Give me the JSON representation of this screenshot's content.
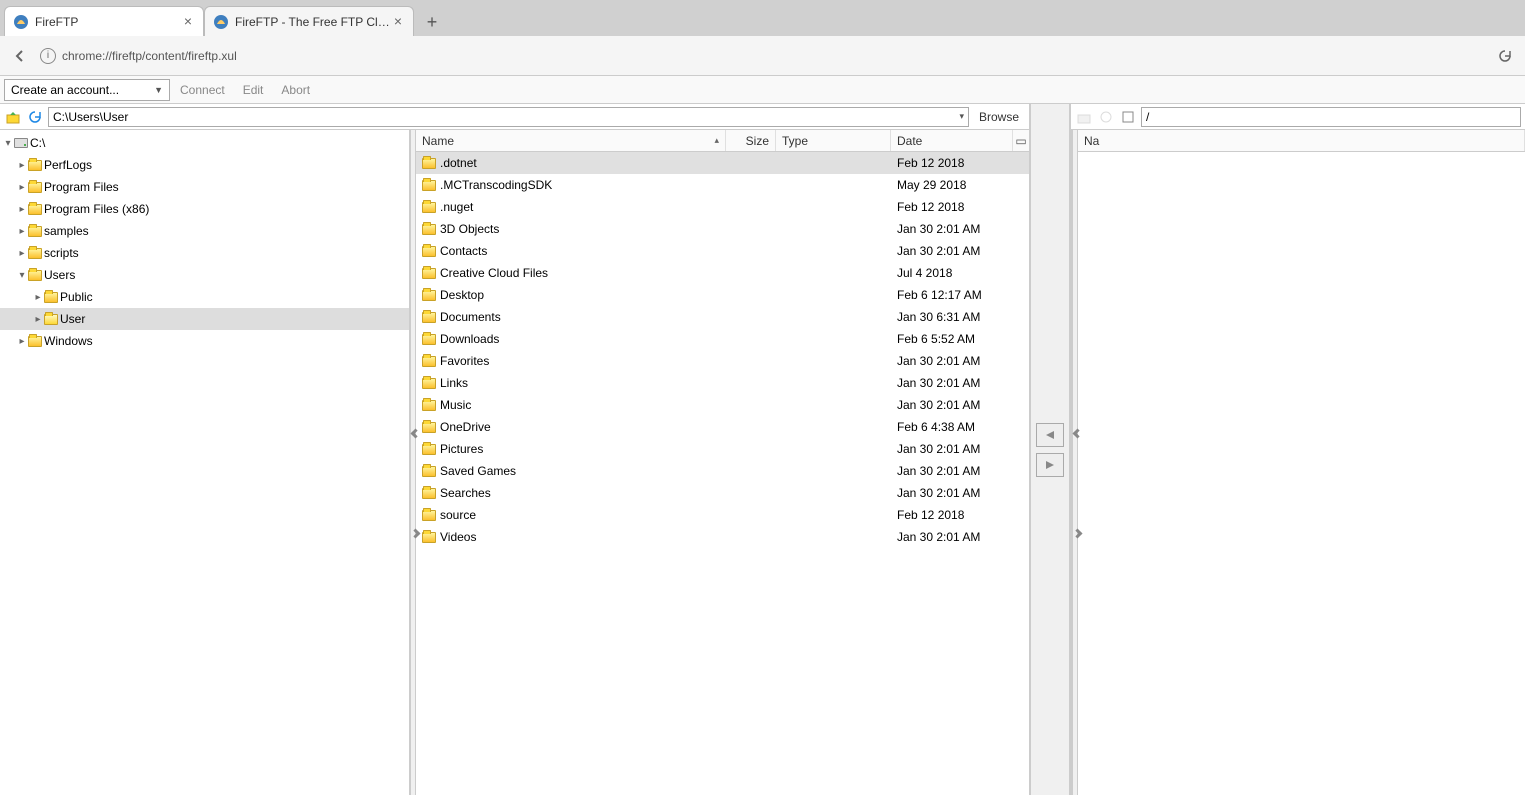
{
  "browser": {
    "tabs": [
      {
        "title": "FireFTP",
        "active": true
      },
      {
        "title": "FireFTP - The Free FTP Clien",
        "active": false
      }
    ],
    "url": "chrome://fireftp/content/fireftp.xul"
  },
  "toolbar": {
    "account_label": "Create an account...",
    "connect": "Connect",
    "edit": "Edit",
    "abort": "Abort"
  },
  "local": {
    "path": "C:\\Users\\User",
    "browse": "Browse",
    "tree": {
      "root": "C:\\",
      "children": [
        {
          "name": "PerfLogs",
          "depth": 1,
          "expandable": true
        },
        {
          "name": "Program Files",
          "depth": 1,
          "expandable": true
        },
        {
          "name": "Program Files (x86)",
          "depth": 1,
          "expandable": true
        },
        {
          "name": "samples",
          "depth": 1,
          "expandable": true
        },
        {
          "name": "scripts",
          "depth": 1,
          "expandable": true
        },
        {
          "name": "Users",
          "depth": 1,
          "expandable": true,
          "expanded": true
        },
        {
          "name": "Public",
          "depth": 2,
          "expandable": true
        },
        {
          "name": "User",
          "depth": 2,
          "expandable": true,
          "selected": true,
          "open": true
        },
        {
          "name": "Windows",
          "depth": 1,
          "expandable": true
        }
      ]
    },
    "columns": {
      "name": "Name",
      "size": "Size",
      "type": "Type",
      "date": "Date"
    },
    "files": [
      {
        "name": ".dotnet",
        "size": "",
        "type": "",
        "date": "Feb 12 2018",
        "selected": true
      },
      {
        "name": ".MCTranscodingSDK",
        "size": "",
        "type": "",
        "date": "May 29 2018"
      },
      {
        "name": ".nuget",
        "size": "",
        "type": "",
        "date": "Feb 12 2018"
      },
      {
        "name": "3D Objects",
        "size": "",
        "type": "",
        "date": "Jan 30 2:01 AM"
      },
      {
        "name": "Contacts",
        "size": "",
        "type": "",
        "date": "Jan 30 2:01 AM"
      },
      {
        "name": "Creative Cloud Files",
        "size": "",
        "type": "",
        "date": "Jul 4 2018"
      },
      {
        "name": "Desktop",
        "size": "",
        "type": "",
        "date": "Feb 6 12:17 AM"
      },
      {
        "name": "Documents",
        "size": "",
        "type": "",
        "date": "Jan 30 6:31 AM"
      },
      {
        "name": "Downloads",
        "size": "",
        "type": "",
        "date": "Feb 6 5:52 AM"
      },
      {
        "name": "Favorites",
        "size": "",
        "type": "",
        "date": "Jan 30 2:01 AM"
      },
      {
        "name": "Links",
        "size": "",
        "type": "",
        "date": "Jan 30 2:01 AM"
      },
      {
        "name": "Music",
        "size": "",
        "type": "",
        "date": "Jan 30 2:01 AM"
      },
      {
        "name": "OneDrive",
        "size": "",
        "type": "",
        "date": "Feb 6 4:38 AM"
      },
      {
        "name": "Pictures",
        "size": "",
        "type": "",
        "date": "Jan 30 2:01 AM"
      },
      {
        "name": "Saved Games",
        "size": "",
        "type": "",
        "date": "Jan 30 2:01 AM"
      },
      {
        "name": "Searches",
        "size": "",
        "type": "",
        "date": "Jan 30 2:01 AM"
      },
      {
        "name": "source",
        "size": "",
        "type": "",
        "date": "Feb 12 2018"
      },
      {
        "name": "Videos",
        "size": "",
        "type": "",
        "date": "Jan 30 2:01 AM"
      }
    ]
  },
  "remote": {
    "path": "/",
    "columns": {
      "name_short": "Na"
    }
  }
}
